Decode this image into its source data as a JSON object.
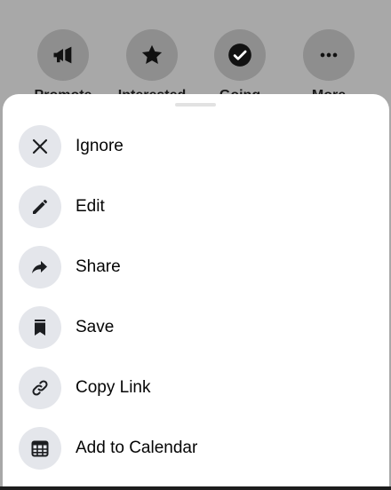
{
  "background": {
    "quick_actions": [
      {
        "label": "Promote",
        "icon": "megaphone-icon"
      },
      {
        "label": "Interested",
        "icon": "star-icon"
      },
      {
        "label": "Going",
        "icon": "check-circle-icon"
      },
      {
        "label": "More",
        "icon": "more-icon"
      }
    ]
  },
  "menu": {
    "items": [
      {
        "label": "Ignore",
        "icon": "close-icon"
      },
      {
        "label": "Edit",
        "icon": "pencil-icon"
      },
      {
        "label": "Share",
        "icon": "share-arrow-icon"
      },
      {
        "label": "Save",
        "icon": "bookmark-icon"
      },
      {
        "label": "Copy Link",
        "icon": "link-icon"
      },
      {
        "label": "Add to Calendar",
        "icon": "calendar-icon"
      }
    ]
  },
  "colors": {
    "backdrop": "#a8a8a8",
    "icon_circle": "#e4e6eb",
    "text": "#050505"
  }
}
